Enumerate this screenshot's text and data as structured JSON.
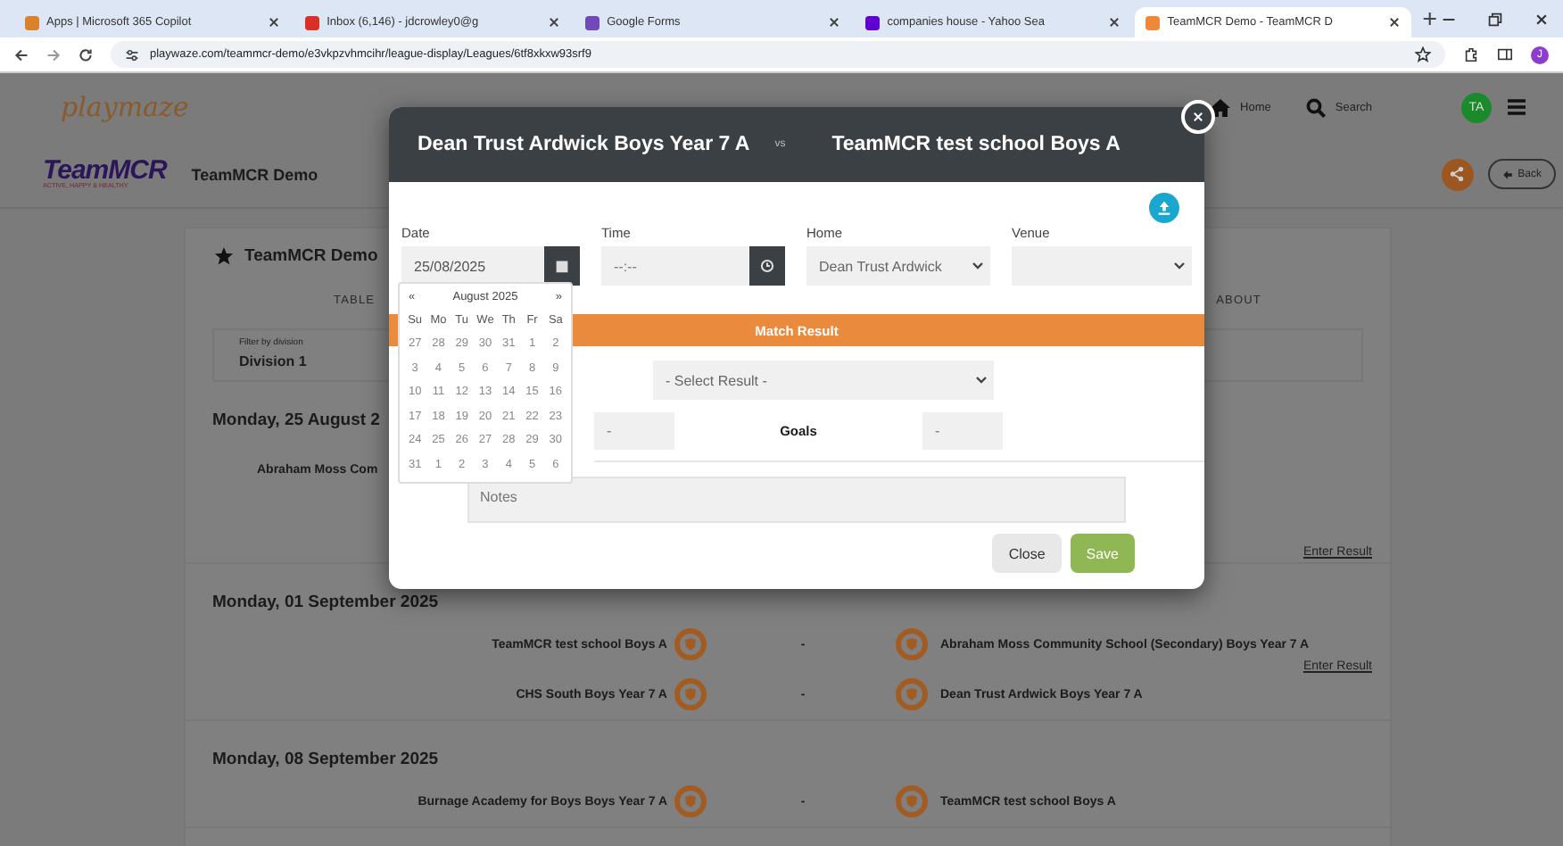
{
  "browser": {
    "tabs": [
      {
        "title": "Apps | Microsoft 365 Copilot",
        "selected": false,
        "color": "#d9822b"
      },
      {
        "title": "Inbox (6,146) - jdcrowley0@g",
        "selected": false,
        "color": "#d93025"
      },
      {
        "title": "Google Forms",
        "selected": false,
        "color": "#7248b9"
      },
      {
        "title": "companies house - Yahoo Sea",
        "selected": false,
        "color": "#6001d2"
      },
      {
        "title": "TeamMCR Demo - TeamMCR D",
        "selected": true,
        "color": "#f0883a"
      }
    ],
    "address": "playwaze.com/teammcr-demo/e3vkpzvhmcihr/league-display/Leagues/6tf8xkxw93srf9",
    "profile": "J"
  },
  "site_header": {
    "logo": "playmaze",
    "nav": [
      {
        "label": "Home",
        "kind": "home"
      },
      {
        "label": "Search",
        "kind": "search"
      }
    ],
    "avatar": "TA"
  },
  "org_bar": {
    "logo_title": "TeamMCR",
    "logo_tagline": "ACTIVE, HAPPY & HEALTHY",
    "title": "TeamMCR Demo",
    "back": "Back"
  },
  "league": {
    "title": "TeamMCR Demo",
    "tabs": [
      {
        "label": "TABLE",
        "selected": false
      },
      {
        "label": "ABOUT",
        "selected": false
      }
    ],
    "filter_label": "Filter by division",
    "filter_value": "Division 1",
    "days": [
      {
        "date": "Monday, 25 August 2",
        "fixtures": [
          {
            "kind": "cut",
            "home": "Abraham Moss Com",
            "action": "Enter Result"
          }
        ]
      },
      {
        "date": "Monday, 01 September 2025",
        "fixtures": [
          {
            "kind": "full",
            "home": "TeamMCR test school Boys A",
            "score": "-",
            "away": "Abraham Moss Community School (Secondary) Boys Year 7 A",
            "action": "Enter Result"
          },
          {
            "kind": "full",
            "home": "CHS South Boys Year 7 A",
            "score": "-",
            "away": "Dean Trust Ardwick Boys Year 7 A"
          }
        ]
      },
      {
        "date": "Monday, 08 September 2025",
        "fixtures": [
          {
            "kind": "full",
            "home": "Burnage Academy for Boys Boys Year 7 A",
            "score": "-",
            "away": "TeamMCR test school Boys A"
          }
        ]
      }
    ]
  },
  "modal": {
    "home_team": "Dean Trust Ardwick Boys Year 7 A",
    "vs": "vs",
    "away_team": "TeamMCR test school Boys A",
    "date": {
      "label": "Date",
      "value": "25/08/2025"
    },
    "time": {
      "label": "Time",
      "placeholder": "--:--"
    },
    "home": {
      "label": "Home",
      "value": "Dean Trust Ardwick"
    },
    "venue": {
      "label": "Venue"
    },
    "section": "Match Result",
    "result_select": "- Select Result -",
    "home_goals": {
      "placeholder": "-"
    },
    "goals_label": "Goals",
    "away_goals": {
      "placeholder": "-"
    },
    "notes": {
      "placeholder": "Notes"
    },
    "buttons": [
      {
        "label": "Close",
        "kind": "secondary"
      },
      {
        "label": "Save",
        "kind": "primary"
      }
    ]
  },
  "calendar": {
    "prev": "«",
    "month": "August 2025",
    "next": "»",
    "weekdays": [
      "Su",
      "Mo",
      "Tu",
      "We",
      "Th",
      "Fr",
      "Sa"
    ],
    "weeks": [
      [
        "27",
        "28",
        "29",
        "30",
        "31",
        "1",
        "2"
      ],
      [
        "3",
        "4",
        "5",
        "6",
        "7",
        "8",
        "9"
      ],
      [
        "10",
        "11",
        "12",
        "13",
        "14",
        "15",
        "16"
      ],
      [
        "17",
        "18",
        "19",
        "20",
        "21",
        "22",
        "23"
      ],
      [
        "24",
        "25",
        "26",
        "27",
        "28",
        "29",
        "30"
      ],
      [
        "31",
        "1",
        "2",
        "3",
        "4",
        "5",
        "6"
      ]
    ]
  }
}
